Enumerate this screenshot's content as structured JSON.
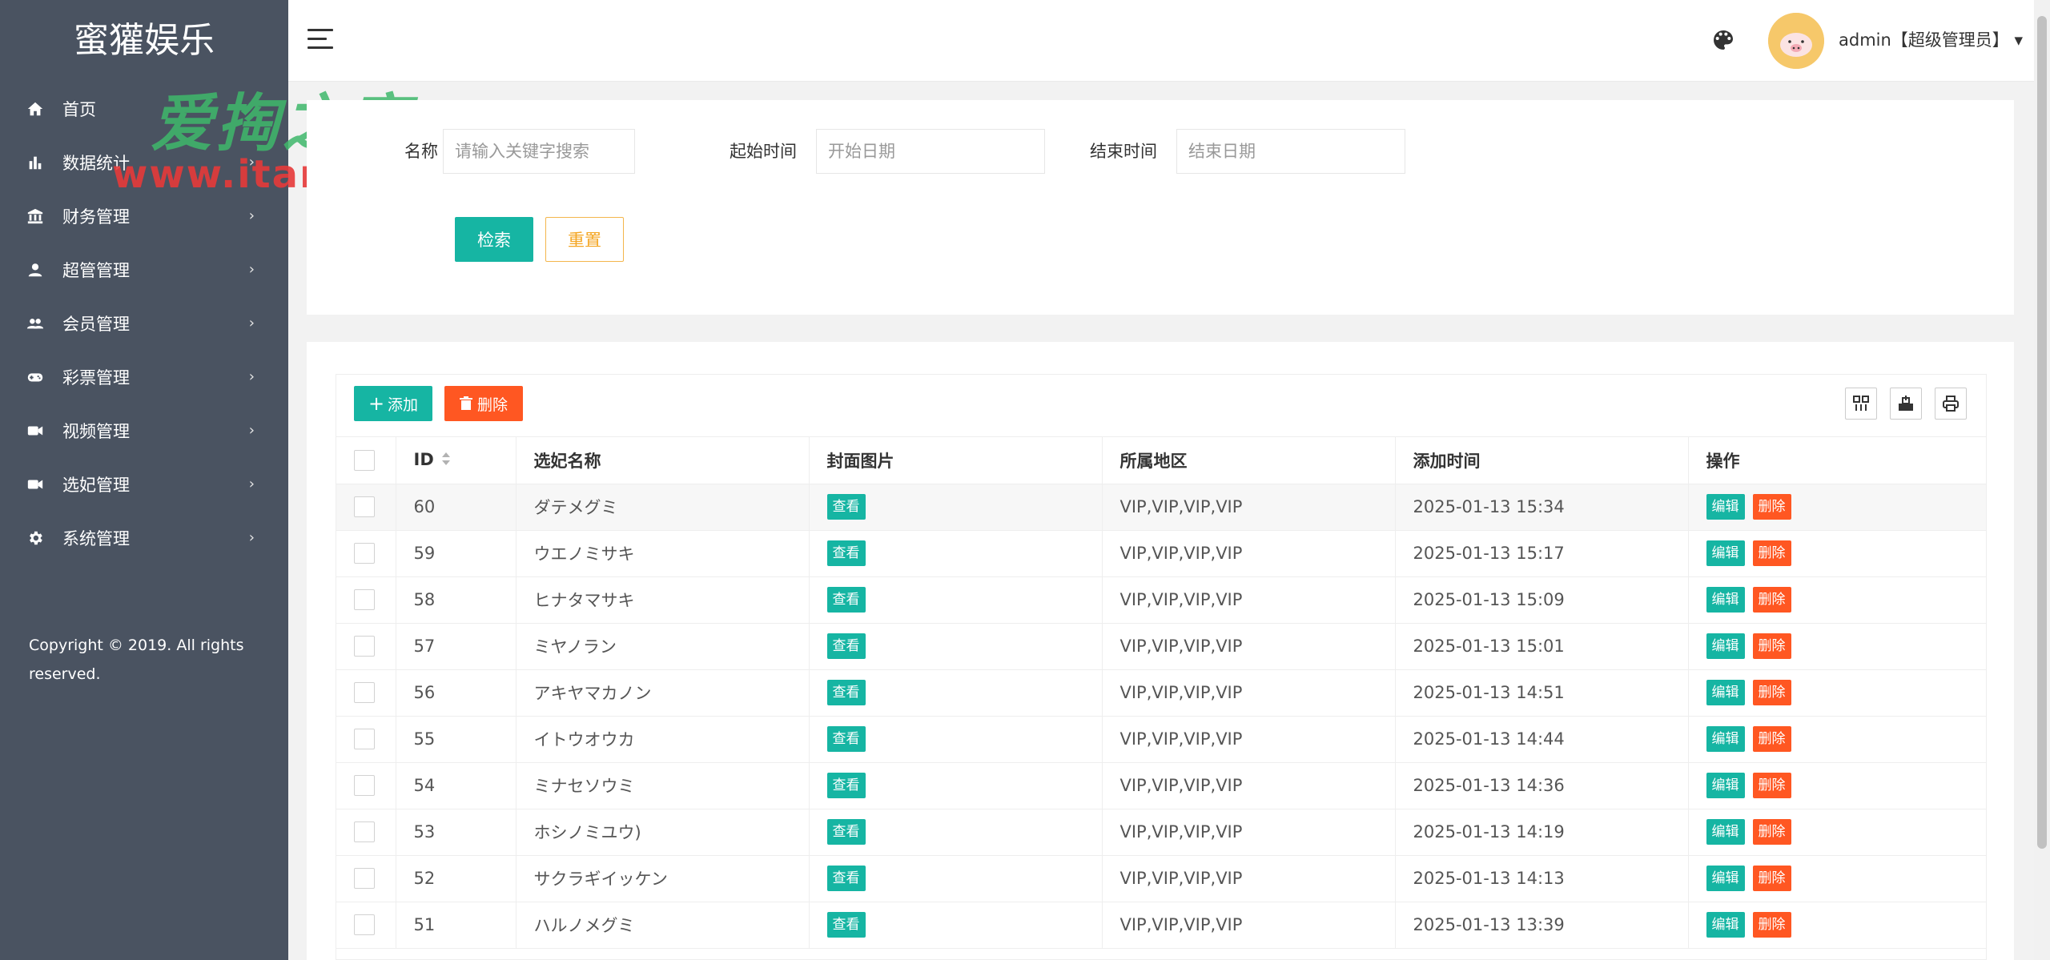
{
  "brand": "蜜獾娱乐",
  "sidebar": {
    "items": [
      {
        "label": "首页",
        "icon": "home-icon",
        "has_children": false
      },
      {
        "label": "数据统计",
        "icon": "bar-chart-icon",
        "has_children": true
      },
      {
        "label": "财务管理",
        "icon": "bank-icon",
        "has_children": true
      },
      {
        "label": "超管管理",
        "icon": "user-icon",
        "has_children": true
      },
      {
        "label": "会员管理",
        "icon": "users-icon",
        "has_children": true
      },
      {
        "label": "彩票管理",
        "icon": "gamepad-icon",
        "has_children": true
      },
      {
        "label": "视频管理",
        "icon": "video-icon",
        "has_children": true
      },
      {
        "label": "选妃管理",
        "icon": "video-icon",
        "has_children": true
      },
      {
        "label": "系统管理",
        "icon": "gear-icon",
        "has_children": true
      }
    ],
    "copyright": "Copyright © 2019. All rights reserved."
  },
  "header": {
    "user": "admin【超级管理员】",
    "dropdown_arrow": "▾"
  },
  "search": {
    "name_label": "名称",
    "name_placeholder": "请输入关键字搜索",
    "start_label": "起始时间",
    "start_placeholder": "开始日期",
    "end_label": "结束时间",
    "end_placeholder": "结束日期",
    "search_btn": "检索",
    "reset_btn": "重置"
  },
  "toolbar": {
    "add_label": "添加",
    "delete_label": "删除"
  },
  "table": {
    "columns": [
      "ID",
      "选妃名称",
      "封面图片",
      "所属地区",
      "添加时间",
      "操作"
    ],
    "view_label": "查看",
    "edit_label": "编辑",
    "del_label": "删除",
    "rows": [
      {
        "id": "60",
        "name": "ダテメグミ",
        "region": "VIP,VIP,VIP,VIP",
        "time": "2025-01-13 15:34"
      },
      {
        "id": "59",
        "name": "ウエノミサキ",
        "region": "VIP,VIP,VIP,VIP",
        "time": "2025-01-13 15:17"
      },
      {
        "id": "58",
        "name": "ヒナタマサキ",
        "region": "VIP,VIP,VIP,VIP",
        "time": "2025-01-13 15:09"
      },
      {
        "id": "57",
        "name": "ミヤノラン",
        "region": "VIP,VIP,VIP,VIP",
        "time": "2025-01-13 15:01"
      },
      {
        "id": "56",
        "name": "アキヤマカノン",
        "region": "VIP,VIP,VIP,VIP",
        "time": "2025-01-13 14:51"
      },
      {
        "id": "55",
        "name": "イトウオウカ",
        "region": "VIP,VIP,VIP,VIP",
        "time": "2025-01-13 14:44"
      },
      {
        "id": "54",
        "name": "ミナセソウミ",
        "region": "VIP,VIP,VIP,VIP",
        "time": "2025-01-13 14:36"
      },
      {
        "id": "53",
        "name": "ホシノミユウ)",
        "region": "VIP,VIP,VIP,VIP",
        "time": "2025-01-13 14:19"
      },
      {
        "id": "52",
        "name": "サクラギイッケン",
        "region": "VIP,VIP,VIP,VIP",
        "time": "2025-01-13 14:13"
      },
      {
        "id": "51",
        "name": "ハルノメグミ",
        "region": "VIP,VIP,VIP,VIP",
        "time": "2025-01-13 13:39"
      }
    ]
  },
  "watermark": {
    "text": "爱掏之家",
    "url": "www.itan.cc"
  },
  "colors": {
    "sidebar_bg": "#4a5361",
    "primary": "#16b5a3",
    "danger": "#ff5722",
    "warning": "#f4a623"
  }
}
